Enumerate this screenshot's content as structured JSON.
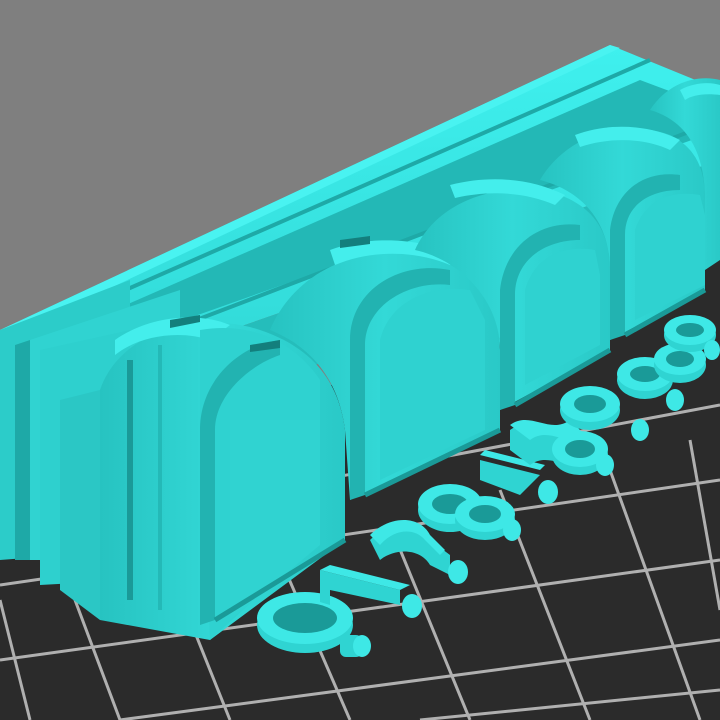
{
  "viewport": {
    "background": "#7f7f7f",
    "bed_color": "#2b2b2b",
    "grid_line_color": "#c8c8c8"
  },
  "model": {
    "color_top": "#3ee8e6",
    "color_face": "#2fd4d2",
    "color_side": "#22b4b2",
    "color_shadow": "#1a9a98",
    "color_dark": "#137f7d",
    "icon": "cyan-3d-part-set"
  }
}
